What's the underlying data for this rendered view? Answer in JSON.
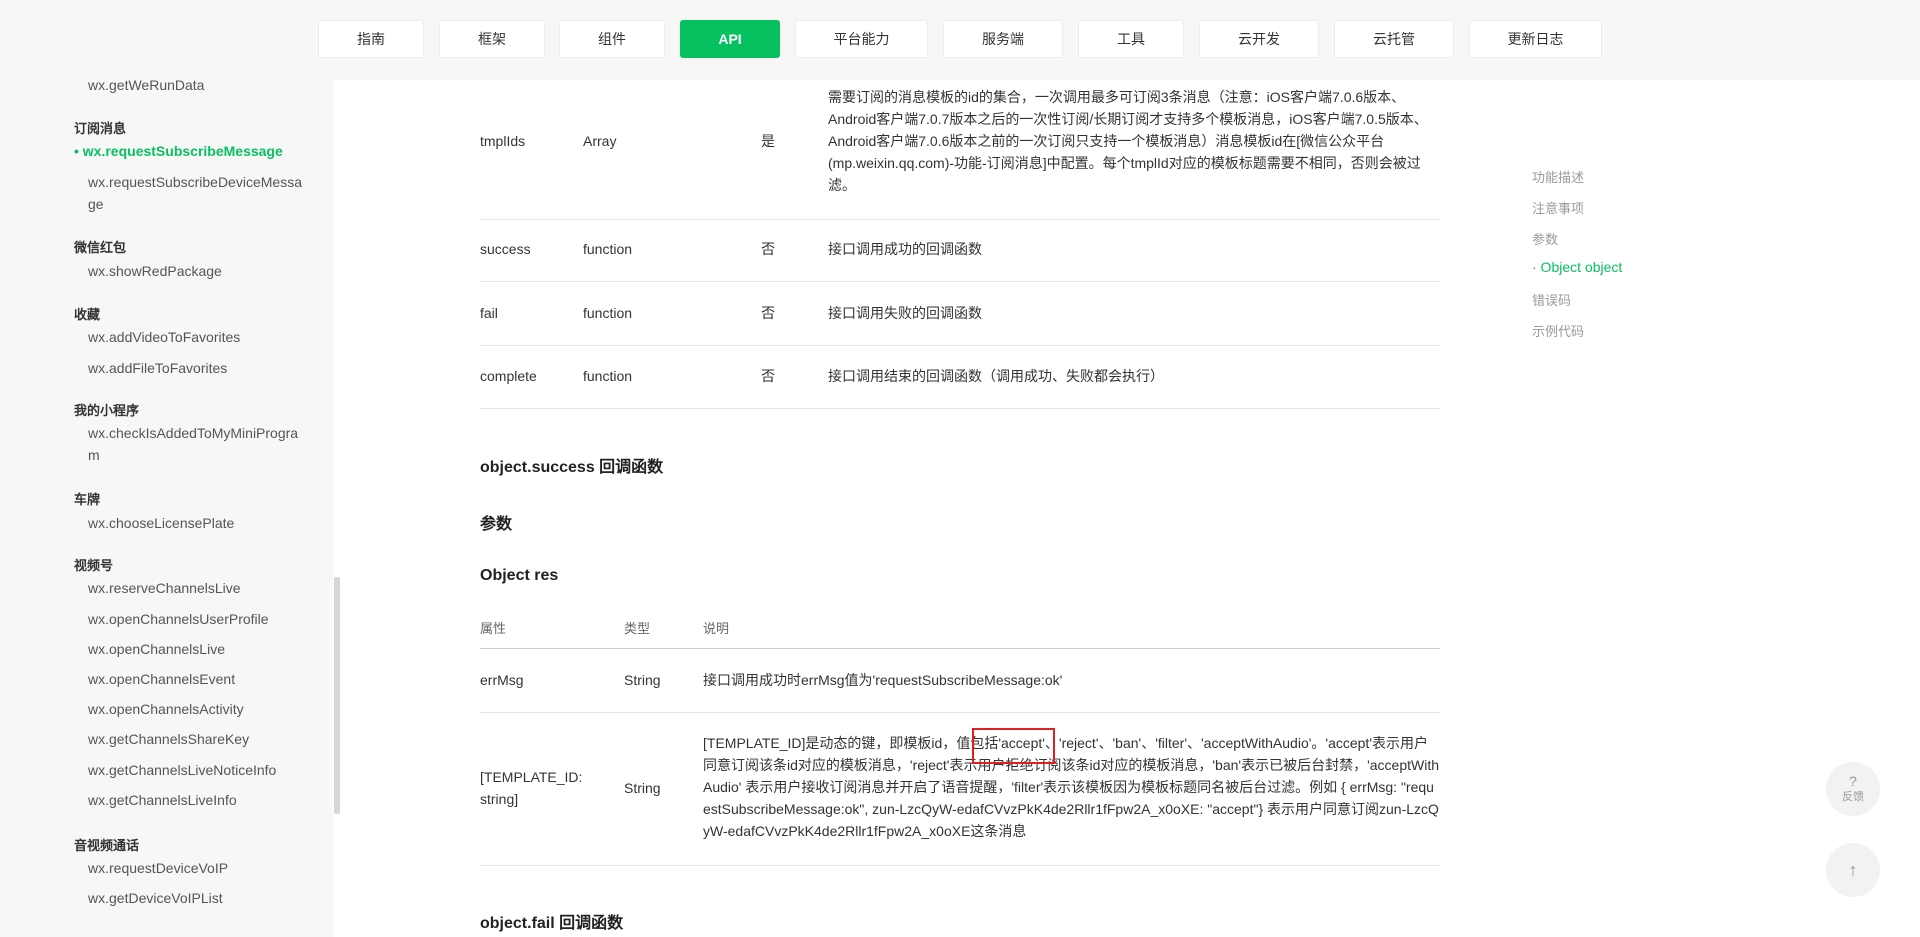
{
  "nav": {
    "items": [
      "指南",
      "框架",
      "组件",
      "API",
      "平台能力",
      "服务端",
      "工具",
      "云开发",
      "云托管",
      "更新日志"
    ],
    "active": "API"
  },
  "sidebar": {
    "top_item": "wx.getWeRunData",
    "groups": [
      {
        "title": "订阅消息",
        "items": [
          "wx.requestSubscribeMessage",
          "wx.requestSubscribeDeviceMessage"
        ],
        "active": "wx.requestSubscribeMessage"
      },
      {
        "title": "微信红包",
        "items": [
          "wx.showRedPackage"
        ]
      },
      {
        "title": "收藏",
        "items": [
          "wx.addVideoToFavorites",
          "wx.addFileToFavorites"
        ]
      },
      {
        "title": "我的小程序",
        "items": [
          "wx.checkIsAddedToMyMiniProgram"
        ]
      },
      {
        "title": "车牌",
        "items": [
          "wx.chooseLicensePlate"
        ]
      },
      {
        "title": "视频号",
        "items": [
          "wx.reserveChannelsLive",
          "wx.openChannelsUserProfile",
          "wx.openChannelsLive",
          "wx.openChannelsEvent",
          "wx.openChannelsActivity",
          "wx.getChannelsShareKey",
          "wx.getChannelsLiveNoticeInfo",
          "wx.getChannelsLiveInfo"
        ]
      },
      {
        "title": "音视频通话",
        "items": [
          "wx.requestDeviceVoIP",
          "wx.getDeviceVoIPList"
        ]
      }
    ]
  },
  "param_table": {
    "rows": [
      {
        "name": "tmplIds",
        "type": "Array",
        "required": "是",
        "desc": "需要订阅的消息模板的id的集合，一次调用最多可订阅3条消息（注意：iOS客户端7.0.6版本、Android客户端7.0.7版本之后的一次性订阅/长期订阅才支持多个模板消息，iOS客户端7.0.5版本、Android客户端7.0.6版本之前的一次订阅只支持一个模板消息）消息模板id在[微信公众平台(mp.weixin.qq.com)-功能-订阅消息]中配置。每个tmplId对应的模板标题需要不相同，否则会被过滤。"
      },
      {
        "name": "success",
        "type": "function",
        "required": "否",
        "desc": "接口调用成功的回调函数"
      },
      {
        "name": "fail",
        "type": "function",
        "required": "否",
        "desc": "接口调用失败的回调函数"
      },
      {
        "name": "complete",
        "type": "function",
        "required": "否",
        "desc": "接口调用结束的回调函数（调用成功、失败都会执行）"
      }
    ]
  },
  "sections": {
    "success_title": "object.success 回调函数",
    "params_title": "参数",
    "object_res_title": "Object res",
    "fail_title": "object.fail 回调函数"
  },
  "res_table": {
    "headers": [
      "属性",
      "类型",
      "说明"
    ],
    "rows": [
      {
        "name": "errMsg",
        "type": "String",
        "desc": "接口调用成功时errMsg值为'requestSubscribeMessage:ok'"
      },
      {
        "name": "[TEMPLATE_ID: string]",
        "type": "String",
        "desc": "[TEMPLATE_ID]是动态的键，即模板id，值包括'accept'、'reject'、'ban'、'filter'、'acceptWithAudio'。'accept'表示用户同意订阅该条id对应的模板消息，'reject'表示用户拒绝订阅该条id对应的模板消息，'ban'表示已被后台封禁，'acceptWithAudio' 表示用户接收订阅消息并开启了语音提醒，'filter'表示该模板因为模板标题同名被后台过滤。例如 { errMsg: \"requestSubscribeMessage:ok\", zun-LzcQyW-edafCVvzPkK4de2Rllr1fFpw2A_x0oXE: \"accept\"} 表示用户同意订阅zun-LzcQyW-edafCVvzPkK4de2Rllr1fFpw2A_x0oXE这条消息"
      }
    ]
  },
  "toc": {
    "items": [
      "功能描述",
      "注意事项",
      "参数",
      "· Object object",
      "错误码",
      "示例代码"
    ],
    "active": "· Object object"
  },
  "float": {
    "feedback_icon": "?",
    "feedback_label": "反馈",
    "top_icon": "↑"
  }
}
